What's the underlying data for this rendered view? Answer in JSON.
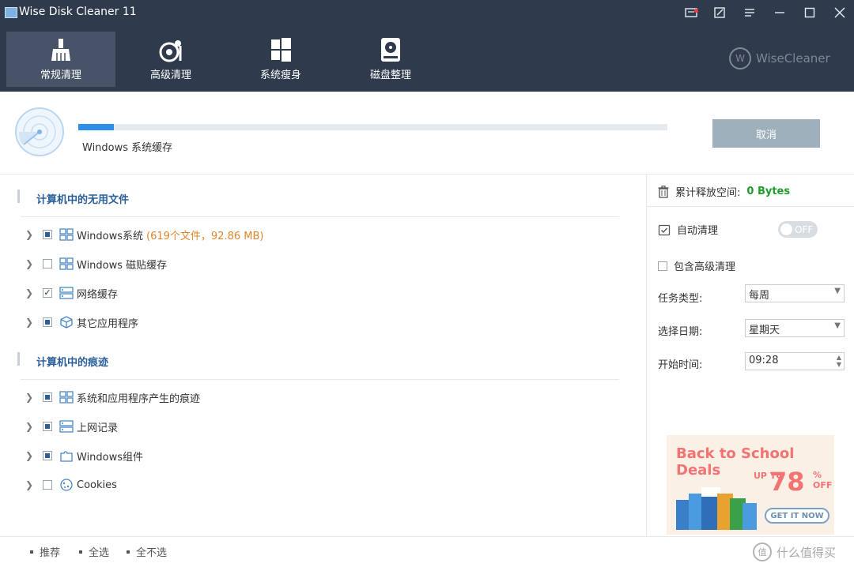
{
  "window": {
    "title": "Wise Disk Cleaner 11"
  },
  "titlebar_icons": [
    "notification-icon",
    "feedback-icon",
    "menu-icon",
    "minimize-icon",
    "maximize-icon",
    "close-icon"
  ],
  "tabs": [
    {
      "label": "常规清理",
      "icon": "broom-icon",
      "active": true
    },
    {
      "label": "高级清理",
      "icon": "advanced-clean-icon",
      "active": false
    },
    {
      "label": "系统瘦身",
      "icon": "windows-slim-icon",
      "active": false
    },
    {
      "label": "磁盘整理",
      "icon": "disk-defrag-icon",
      "active": false
    }
  ],
  "brand": {
    "logo": "W",
    "name": "WiseCleaner"
  },
  "scan": {
    "status": "Windows 系统缓存",
    "progress": 0.06,
    "cancel_label": "取消"
  },
  "sections": [
    {
      "title": "计算机中的无用文件",
      "items": [
        {
          "label": "Windows系统",
          "info": "(619个文件，92.86 MB)",
          "check": "partial",
          "icon": "windows-grid-icon"
        },
        {
          "label": "Windows 磁贴缓存",
          "info": "",
          "check": "unchecked",
          "icon": "tiles-icon"
        },
        {
          "label": "网络缓存",
          "info": "",
          "check": "checked",
          "icon": "network-cache-icon"
        },
        {
          "label": "其它应用程序",
          "info": "",
          "check": "partial",
          "icon": "package-icon"
        }
      ]
    },
    {
      "title": "计算机中的痕迹",
      "items": [
        {
          "label": "系统和应用程序产生的痕迹",
          "info": "",
          "check": "partial",
          "icon": "windows-grid-icon"
        },
        {
          "label": "上网记录",
          "info": "",
          "check": "partial",
          "icon": "browser-history-icon"
        },
        {
          "label": "Windows组件",
          "info": "",
          "check": "partial",
          "icon": "component-icon"
        },
        {
          "label": "Cookies",
          "info": "",
          "check": "unchecked",
          "icon": "cookie-icon"
        }
      ]
    }
  ],
  "sidebar": {
    "freed_label": "累计释放空间:",
    "freed_value": "0 Bytes",
    "auto_clean_label": "自动清理",
    "toggle_text": "OFF",
    "include_advanced_label": "包含高级清理",
    "task_type_label": "任务类型:",
    "task_type_value": "每周",
    "date_label": "选择日期:",
    "date_value": "星期天",
    "time_label": "开始时间:",
    "time_value": "09:28"
  },
  "ad": {
    "title": "Back to School Deals",
    "up": "UP TO",
    "discount": "78",
    "off": "% OFF",
    "button": "GET IT NOW"
  },
  "bottom": {
    "recommend": "推荐",
    "select_all": "全选",
    "select_none": "全不选"
  },
  "watermark": {
    "logo": "值",
    "text": "什么值得买"
  },
  "colors": {
    "topbar": "#2f3a4c",
    "active_tab": "#475367",
    "accent": "#2b8ee8",
    "section_title": "#2a5f9a",
    "info": "#e0852b",
    "freed": "#1f9c2c"
  }
}
